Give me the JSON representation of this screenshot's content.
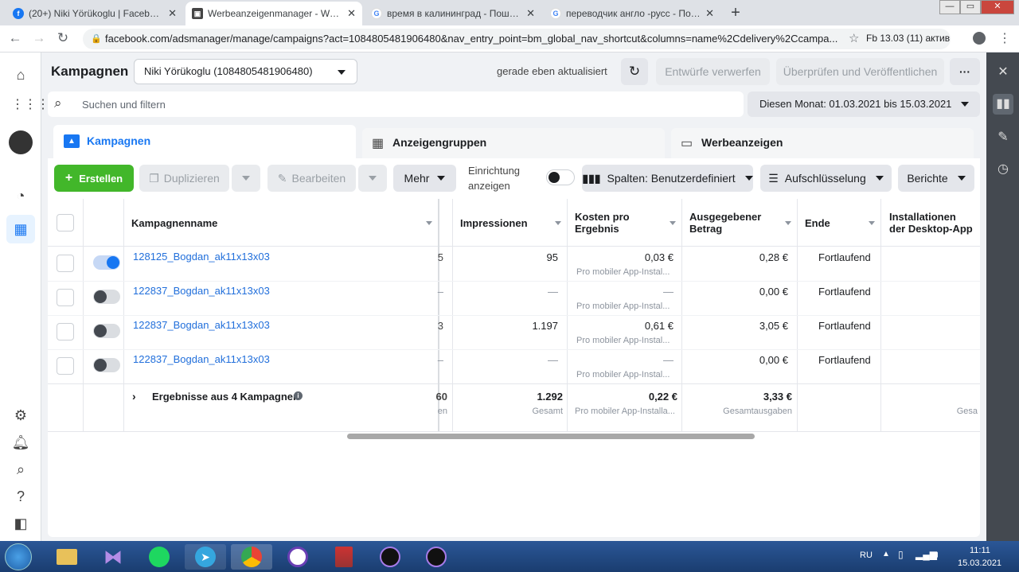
{
  "browser": {
    "tabs": [
      {
        "title": "(20+) Niki Yörükoglu | Facebook",
        "favicon": "facebook-icon"
      },
      {
        "title": "Werbeanzeigenmanager - Werbe",
        "favicon": "adsmanager-icon"
      },
      {
        "title": "время в калининград - Пошук G",
        "favicon": "google-icon"
      },
      {
        "title": "переводчик англо -русс - Пошу",
        "favicon": "google-icon"
      }
    ],
    "url": "facebook.com/adsmanager/manage/campaigns?act=1084805481906480&nav_entry_point=bm_global_nav_shortcut&columns=name%2Cdelivery%2Ccampa...",
    "profile_chip": "Fb 13.03 (11) актив"
  },
  "header": {
    "title": "Kampagnen",
    "account": "Niki Yörükoglu (1084805481906480)",
    "status": "gerade eben aktualisiert",
    "discard_label": "Entwürfe verwerfen",
    "publish_label": "Überprüfen und Veröffentlichen",
    "more_label": "···"
  },
  "search": {
    "placeholder": "Suchen und filtern",
    "date_range": "Diesen Monat: 01.03.2021 bis 15.03.2021"
  },
  "level_tabs": [
    {
      "label": "Kampagnen"
    },
    {
      "label": "Anzeigengruppen"
    },
    {
      "label": "Werbeanzeigen"
    }
  ],
  "toolbar": {
    "create": "Erstellen",
    "duplicate": "Duplizieren",
    "edit": "Bearbeiten",
    "more": "Mehr",
    "setup_line1": "Einrichtung",
    "setup_line2": "anzeigen",
    "columns": "Spalten: Benutzerdefiniert",
    "breakdown": "Aufschlüsselung",
    "reports": "Berichte"
  },
  "table": {
    "headers": {
      "name": "Kampagnenname",
      "impressions": "Impressionen",
      "cost1": "Kosten pro",
      "cost2": "Ergebnis",
      "spent1": "Ausgegebener",
      "spent2": "Betrag",
      "end": "Ende",
      "install1": "Installationen",
      "install2": "der Desktop-App"
    },
    "rows": [
      {
        "name": "128125_Bogdan_ak11x13x03",
        "active": true,
        "cut": "5",
        "impressions": "95",
        "cost": "0,03 €",
        "cost_sub": "Pro mobiler App-Instal...",
        "spent": "0,28 €",
        "end": "Fortlaufend"
      },
      {
        "name": "122837_Bogdan_ak11x13x03",
        "active": false,
        "cut": "–",
        "impressions": "—",
        "cost": "—",
        "cost_sub": "Pro mobiler App-Instal...",
        "spent": "0,00 €",
        "end": "Fortlaufend"
      },
      {
        "name": "122837_Bogdan_ak11x13x03",
        "active": false,
        "cut": "3",
        "impressions": "1.197",
        "cost": "0,61 €",
        "cost_sub": "Pro mobiler App-Instal...",
        "spent": "3,05 €",
        "end": "Fortlaufend"
      },
      {
        "name": "122837_Bogdan_ak11x13x03",
        "active": false,
        "cut": "–",
        "impressions": "—",
        "cost": "—",
        "cost_sub": "Pro mobiler App-Instal...",
        "spent": "0,00 €",
        "end": "Fortlaufend"
      }
    ],
    "summary": {
      "label": "Ergebnisse aus 4 Kampagnen",
      "cut": "60",
      "cut_sub": "en",
      "impressions": "1.292",
      "impressions_sub": "Gesamt",
      "cost": "0,22 €",
      "cost_sub": "Pro mobiler App-Installa...",
      "spent": "3,33 €",
      "spent_sub": "Gesamtausgaben",
      "install_sub": "Gesa"
    }
  },
  "taskbar": {
    "lang": "RU",
    "time": "11:11",
    "date": "15.03.2021"
  },
  "colors": {
    "accent": "#1877f2",
    "create_green": "#42b72a",
    "link": "#216fdb"
  }
}
